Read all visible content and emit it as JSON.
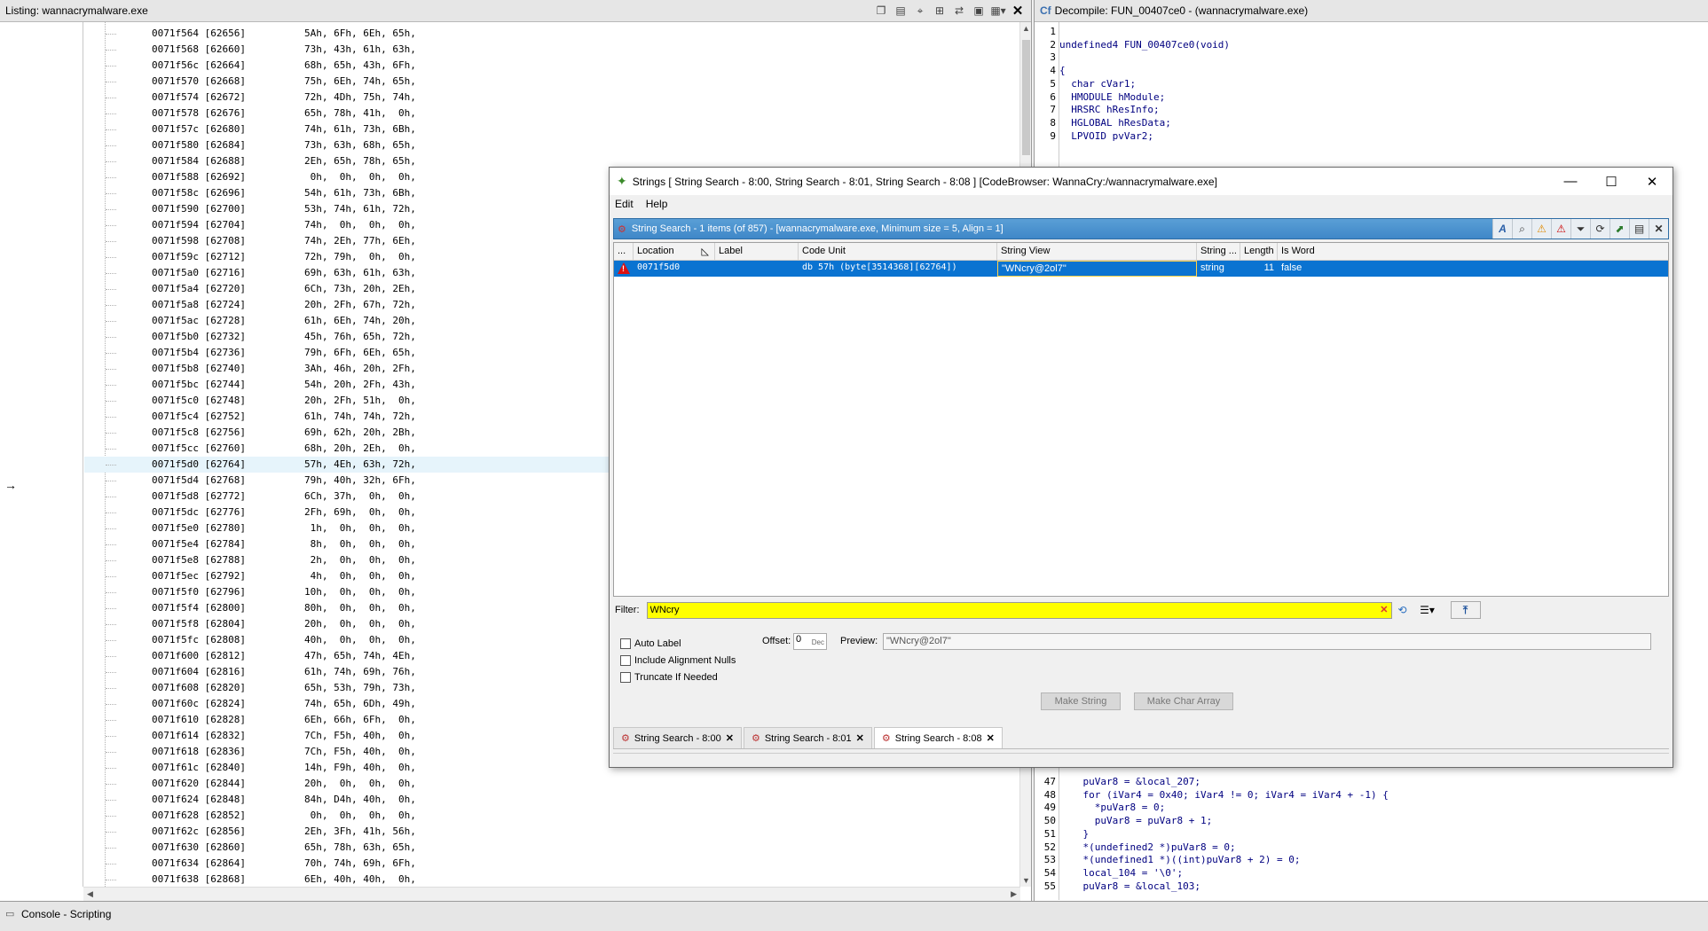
{
  "listing": {
    "title": "Listing:  wannacrymalware.exe",
    "rows": [
      [
        "0071f564 [62656]",
        "5Ah, 6Fh, 6Eh, 65h,"
      ],
      [
        "0071f568 [62660]",
        "73h, 43h, 61h, 63h,"
      ],
      [
        "0071f56c [62664]",
        "68h, 65h, 43h, 6Fh,"
      ],
      [
        "0071f570 [62668]",
        "75h, 6Eh, 74h, 65h,"
      ],
      [
        "0071f574 [62672]",
        "72h, 4Dh, 75h, 74h,"
      ],
      [
        "0071f578 [62676]",
        "65h, 78h, 41h,  0h,"
      ],
      [
        "0071f57c [62680]",
        "74h, 61h, 73h, 6Bh,"
      ],
      [
        "0071f580 [62684]",
        "73h, 63h, 68h, 65h,"
      ],
      [
        "0071f584 [62688]",
        "2Eh, 65h, 78h, 65h,"
      ],
      [
        "0071f588 [62692]",
        " 0h,  0h,  0h,  0h,"
      ],
      [
        "0071f58c [62696]",
        "54h, 61h, 73h, 6Bh,"
      ],
      [
        "0071f590 [62700]",
        "53h, 74h, 61h, 72h,"
      ],
      [
        "0071f594 [62704]",
        "74h,  0h,  0h,  0h,"
      ],
      [
        "0071f598 [62708]",
        "74h, 2Eh, 77h, 6Eh,"
      ],
      [
        "0071f59c [62712]",
        "72h, 79h,  0h,  0h,"
      ],
      [
        "0071f5a0 [62716]",
        "69h, 63h, 61h, 63h,"
      ],
      [
        "0071f5a4 [62720]",
        "6Ch, 73h, 20h, 2Eh,"
      ],
      [
        "0071f5a8 [62724]",
        "20h, 2Fh, 67h, 72h,"
      ],
      [
        "0071f5ac [62728]",
        "61h, 6Eh, 74h, 20h,"
      ],
      [
        "0071f5b0 [62732]",
        "45h, 76h, 65h, 72h,"
      ],
      [
        "0071f5b4 [62736]",
        "79h, 6Fh, 6Eh, 65h,"
      ],
      [
        "0071f5b8 [62740]",
        "3Ah, 46h, 20h, 2Fh,"
      ],
      [
        "0071f5bc [62744]",
        "54h, 20h, 2Fh, 43h,"
      ],
      [
        "0071f5c0 [62748]",
        "20h, 2Fh, 51h,  0h,"
      ],
      [
        "0071f5c4 [62752]",
        "61h, 74h, 74h, 72h,"
      ],
      [
        "0071f5c8 [62756]",
        "69h, 62h, 20h, 2Bh,"
      ],
      [
        "0071f5cc [62760]",
        "68h, 20h, 2Eh,  0h,"
      ],
      [
        "0071f5d0 [62764]",
        "57h, 4Eh, 63h, 72h,"
      ],
      [
        "0071f5d4 [62768]",
        "79h, 40h, 32h, 6Fh,"
      ],
      [
        "0071f5d8 [62772]",
        "6Ch, 37h,  0h,  0h,"
      ],
      [
        "0071f5dc [62776]",
        "2Fh, 69h,  0h,  0h,"
      ],
      [
        "0071f5e0 [62780]",
        " 1h,  0h,  0h,  0h,"
      ],
      [
        "0071f5e4 [62784]",
        " 8h,  0h,  0h,  0h,"
      ],
      [
        "0071f5e8 [62788]",
        " 2h,  0h,  0h,  0h,"
      ],
      [
        "0071f5ec [62792]",
        " 4h,  0h,  0h,  0h,"
      ],
      [
        "0071f5f0 [62796]",
        "10h,  0h,  0h,  0h,"
      ],
      [
        "0071f5f4 [62800]",
        "80h,  0h,  0h,  0h,"
      ],
      [
        "0071f5f8 [62804]",
        "20h,  0h,  0h,  0h,"
      ],
      [
        "0071f5fc [62808]",
        "40h,  0h,  0h,  0h,"
      ],
      [
        "0071f600 [62812]",
        "47h, 65h, 74h, 4Eh,"
      ],
      [
        "0071f604 [62816]",
        "61h, 74h, 69h, 76h,"
      ],
      [
        "0071f608 [62820]",
        "65h, 53h, 79h, 73h,"
      ],
      [
        "0071f60c [62824]",
        "74h, 65h, 6Dh, 49h,"
      ],
      [
        "0071f610 [62828]",
        "6Eh, 66h, 6Fh,  0h,"
      ],
      [
        "0071f614 [62832]",
        "7Ch, F5h, 40h,  0h,"
      ],
      [
        "0071f618 [62836]",
        "7Ch, F5h, 40h,  0h,"
      ],
      [
        "0071f61c [62840]",
        "14h, F9h, 40h,  0h,"
      ],
      [
        "0071f620 [62844]",
        "20h,  0h,  0h,  0h,"
      ],
      [
        "0071f624 [62848]",
        "84h, D4h, 40h,  0h,"
      ],
      [
        "0071f628 [62852]",
        " 0h,  0h,  0h,  0h,"
      ],
      [
        "0071f62c [62856]",
        "2Eh, 3Fh, 41h, 56h,"
      ],
      [
        "0071f630 [62860]",
        "65h, 78h, 63h, 65h,"
      ],
      [
        "0071f634 [62864]",
        "70h, 74h, 69h, 6Fh,"
      ],
      [
        "0071f638 [62868]",
        "6Eh, 40h, 40h,  0h,"
      ]
    ],
    "selected_index": 27
  },
  "decompile": {
    "title": "Decompile: FUN_00407ce0 -  (wannacrymalware.exe)",
    "top_lines": [
      [
        "1",
        ""
      ],
      [
        "2",
        "undefined4 FUN_00407ce0(void)"
      ],
      [
        "3",
        ""
      ],
      [
        "4",
        "{"
      ],
      [
        "5",
        "  char cVar1;"
      ],
      [
        "6",
        "  HMODULE hModule;"
      ],
      [
        "7",
        "  HRSRC hResInfo;"
      ],
      [
        "8",
        "  HGLOBAL hResData;"
      ],
      [
        "9",
        "  LPVOID pvVar2;"
      ]
    ],
    "bottom_lines": [
      [
        "47",
        "    puVar8 = &local_207;"
      ],
      [
        "48",
        "    for (iVar4 = 0x40; iVar4 != 0; iVar4 = iVar4 + -1) {"
      ],
      [
        "49",
        "      *puVar8 = 0;"
      ],
      [
        "50",
        "      puVar8 = puVar8 + 1;"
      ],
      [
        "51",
        "    }"
      ],
      [
        "52",
        "    *(undefined2 *)puVar8 = 0;"
      ],
      [
        "53",
        "    *(undefined1 *)((int)puVar8 + 2) = 0;"
      ],
      [
        "54",
        "    local_104 = '\\0';"
      ],
      [
        "55",
        "    puVar8 = &local_103;"
      ]
    ]
  },
  "console": {
    "title": "Console - Scripting"
  },
  "strings_window": {
    "title": "Strings [ String Search - 8:00, String Search - 8:01, String Search - 8:08 ] [CodeBrowser: WannaCry:/wannacrymalware.exe]",
    "menu": [
      "Edit",
      "Help"
    ],
    "provider_title": "String Search - 1 items (of 857) - [wannacrymalware.exe, Minimum size = 5, Align = 1]",
    "columns": [
      "...",
      "Location",
      "Label",
      "Code Unit",
      "String View",
      "String ...",
      "Length",
      "Is Word"
    ],
    "row": {
      "location": "0071f5d0",
      "label": "",
      "code_unit": "db 57h  (byte[3514368][62764])",
      "string_view": "\"WNcry@2ol7\"",
      "string_type": "string",
      "length": "11",
      "is_word": "false"
    },
    "filter_label": "Filter:",
    "filter_value": "WNcry",
    "options": {
      "auto_label": "Auto Label",
      "include_nulls": "Include Alignment Nulls",
      "truncate": "Truncate If Needed",
      "offset_label": "Offset:",
      "offset_value": "0",
      "offset_unit": "Dec",
      "preview_label": "Preview:",
      "preview_value": "\"WNcry@2ol7\"",
      "make_string": "Make String",
      "make_char_array": "Make Char Array"
    },
    "tabs": [
      "String Search - 8:00",
      "String Search - 8:01",
      "String Search - 8:08"
    ],
    "active_tab": 2
  }
}
